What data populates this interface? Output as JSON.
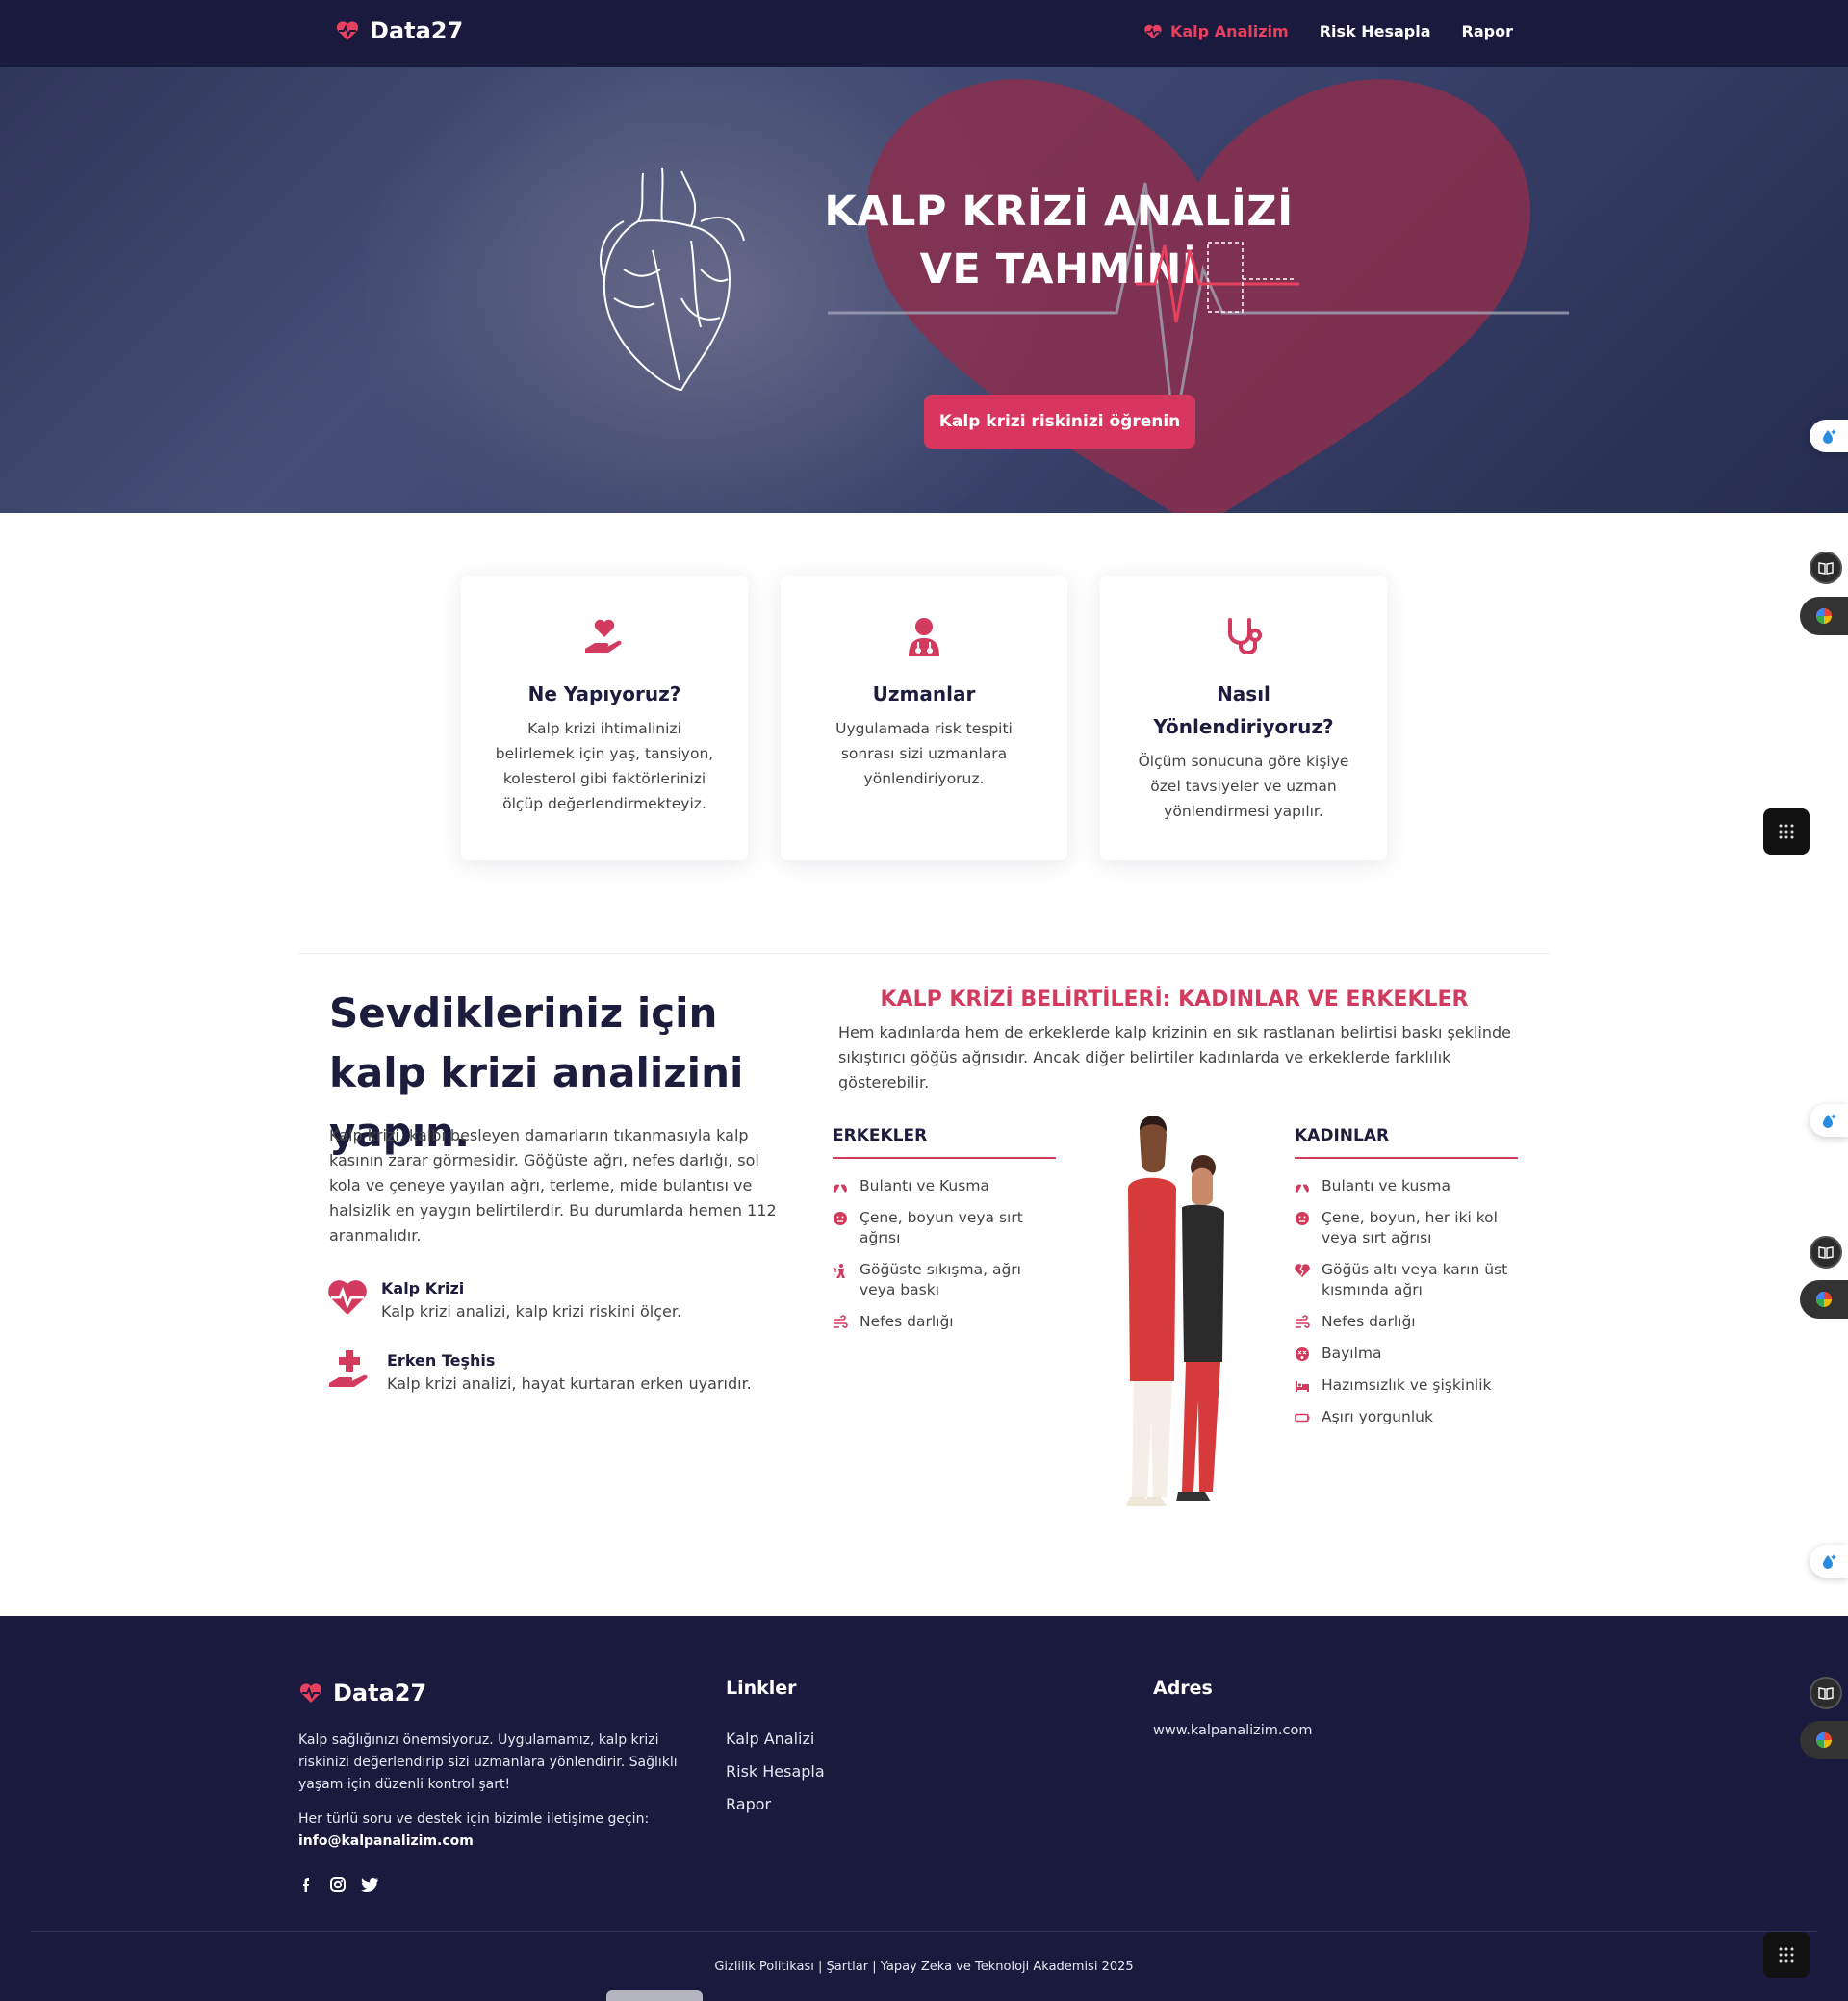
{
  "brand": {
    "name": "Data27"
  },
  "nav": {
    "items": [
      {
        "label": "Kalp Analizim",
        "active": true
      },
      {
        "label": "Risk Hesapla",
        "active": false
      },
      {
        "label": "Rapor",
        "active": false
      }
    ]
  },
  "hero": {
    "title": "KALP KRİZİ ANALİZİ VE TAHMİNİ",
    "cta": "Kalp krizi riskinizi öğrenin"
  },
  "cards": [
    {
      "icon": "hand-heart-icon",
      "title": "Ne Yapıyoruz?",
      "text": "Kalp krizi ihtimalinizi belirlemek için yaş, tansiyon, kolesterol gibi faktörlerinizi ölçüp değerlendirmekteyiz."
    },
    {
      "icon": "doctor-icon",
      "title": "Uzmanlar",
      "text": "Uygulamada risk tespiti sonrası sizi uzmanlara yönlendiriyoruz."
    },
    {
      "icon": "stethoscope-icon",
      "title": "Nasıl Yönlendiriyoruz?",
      "text": "Ölçüm sonucuna göre kişiye özel tavsiyeler ve uzman yönlendirmesi yapılır."
    }
  ],
  "info": {
    "title": "Sevdikleriniz için kalp krizi analizini yapın.",
    "text": "Kalp krizi, kalbi besleyen damarların tıkanmasıyla kalp kasının zarar görmesidir. Göğüste ağrı, nefes darlığı, sol kola ve çeneye yayılan ağrı, terleme, mide bulantısı ve halsizlik en yaygın belirtilerdir. Bu durumlarda hemen 112 aranmalıdır.",
    "features": [
      {
        "title": "Kalp Krizi",
        "desc": "Kalp krizi analizi, kalp krizi riskini ölçer."
      },
      {
        "title": "Erken Teşhis",
        "desc": "Kalp krizi analizi, hayat kurtaran erken uyarıdır."
      }
    ]
  },
  "symptoms": {
    "title": "KALP KRİZİ BELİRTİLERİ: KADINLAR VE ERKEKLER",
    "intro": "Hem kadınlarda hem de erkeklerde kalp krizinin en sık rastlanan belirtisi baskı şeklinde sıkıştırıcı göğüs ağrısıdır. Ancak diğer belirtiler kadınlarda ve erkeklerde farklılık gösterebilir.",
    "men": {
      "heading": "ERKEKLER",
      "items": [
        "Bulantı ve Kusma",
        "Çene, boyun veya sırt ağrısı",
        "Göğüste sıkışma, ağrı veya baskı",
        "Nefes darlığı"
      ]
    },
    "women": {
      "heading": "KADINLAR",
      "items": [
        "Bulantı ve kusma",
        "Çene, boyun, her iki kol veya sırt ağrısı",
        "Göğüs altı veya karın üst kısmında ağrı",
        "Nefes darlığı",
        "Bayılma",
        "Hazımsızlık ve şişkinlik",
        "Aşırı yorgunluk"
      ]
    }
  },
  "footer": {
    "brand": "Data27",
    "about": "Kalp sağlığınızı önemsiyoruz. Uygulamamız, kalp krizi riskinizi değerlendirip sizi uzmanlara yönlendirir. Sağlıklı yaşam için düzenli kontrol şart!",
    "contact_text": "Her türlü soru ve destek için bizimle iletişime geçin:",
    "email": "info@kalpanalizim.com",
    "links_title": "Linkler",
    "links": [
      "Kalp Analizi",
      "Risk Hesapla",
      "Rapor"
    ],
    "address_title": "Adres",
    "address": "www.kalpanalizim.com",
    "bottom": "Gizlilik Politikası | Şartlar | Yapay Zeka ve Teknoloji Akademisi 2025"
  },
  "colors": {
    "navy": "#1a1a3f",
    "accent": "#d8365e",
    "text": "#1c1c3c"
  }
}
